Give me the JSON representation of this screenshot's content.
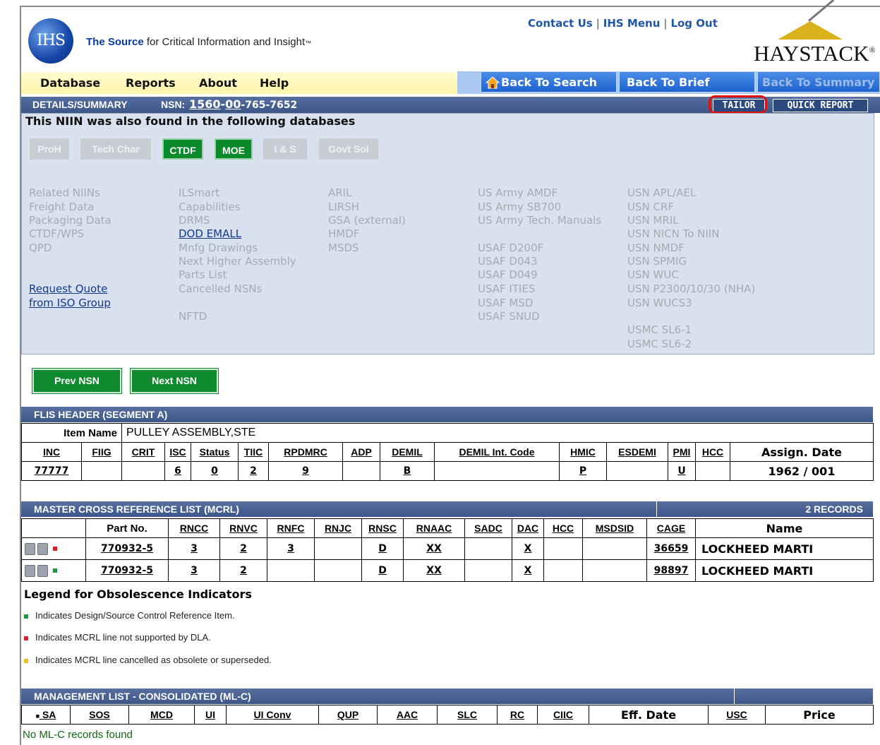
{
  "header": {
    "logo_text": "IHS",
    "tagline_brand": "The Source",
    "tagline_rest": " for Critical Information and Insight",
    "tagline_tm": "™",
    "links": [
      "Contact Us",
      "IHS Menu",
      "Log Out"
    ],
    "haystack_logo": "HAYSTACK",
    "haystack_reg": "®"
  },
  "menu": {
    "items": [
      "Database",
      "Reports",
      "About",
      "Help"
    ],
    "back_to_search": "Back To Search",
    "back_to_brief": "Back To Brief",
    "back_to_summary": "Back To Summary",
    "home_icon": "home-icon"
  },
  "details": {
    "label": "DETAILS/SUMMARY",
    "nsn_label": "NSN:",
    "nsn_part1": "1560",
    "nsn_dash1": "-",
    "nsn_part2": "00",
    "nsn_part3": "-765-7652",
    "tailor": "TAILOR",
    "quick_report": "QUICK REPORT"
  },
  "databases": {
    "title": "This NIIN was also found in the following databases",
    "buttons": [
      {
        "label": "ProH",
        "active": false
      },
      {
        "label": "Tech Char",
        "active": false
      },
      {
        "label": "CTDF",
        "active": true
      },
      {
        "label": "MOE",
        "active": true
      },
      {
        "label": "I & S",
        "active": false
      },
      {
        "label": "Govt Sol",
        "active": false
      }
    ],
    "col1": [
      "Related NIINs",
      "Freight Data",
      "Packaging Data",
      "CTDF/WPS",
      "QPD"
    ],
    "request_quote_1": "Request Quote",
    "request_quote_2": "from ISO Group",
    "col2": [
      "ILSmart",
      "Capabilities",
      "DRMS",
      "DOD EMALL",
      "Mnfg Drawings",
      "Next Higher Assembly",
      "Parts List",
      "Cancelled NSNs",
      "",
      "NFTD"
    ],
    "col3": [
      "ARIL",
      "LIRSH",
      "GSA (external)",
      "HMDF",
      "MSDS"
    ],
    "col4a": [
      "US Army AMDF",
      "US Army SB700",
      "US Army Tech. Manuals"
    ],
    "col4b": [
      "USAF D200F",
      "USAF D043",
      "USAF D049",
      "USAF ITIES",
      "USAF MSD",
      "USAF SNUD"
    ],
    "col5a": [
      "USN APL/AEL",
      "USN CRF",
      "USN MRIL",
      "USN NICN To NIIN",
      "USN NMDF",
      "USN SPMIG",
      "USN WUC",
      "USN P2300/10/30 (NHA)",
      "USN WUCS3"
    ],
    "col5b": [
      "USMC SL6-1",
      "USMC SL6-2"
    ]
  },
  "nav": {
    "prev": "Prev NSN",
    "next": "Next NSN"
  },
  "flis": {
    "title": "FLIS HEADER (SEGMENT A)",
    "item_name_label": "Item Name",
    "item_name": "PULLEY ASSEMBLY,STE",
    "headers": [
      "INC",
      "FIIG",
      "CRIT",
      "ISC",
      "Status",
      "TIIC",
      "RPDMRC",
      "ADP",
      "DEMIL",
      "DEMIL Int. Code",
      "HMIC",
      "ESDEMI",
      "PMI",
      "HCC",
      "Assign. Date"
    ],
    "row": [
      "77777",
      "",
      "",
      "6",
      "0",
      "2",
      "9",
      "",
      "B",
      "",
      "P",
      "",
      "U",
      "",
      "1962 / 001"
    ]
  },
  "mcrl": {
    "title": "MASTER CROSS REFERENCE LIST (MCRL)",
    "records": "2 RECORDS",
    "headers": [
      "",
      "Part No.",
      "RNCC",
      "RNVC",
      "RNFC",
      "RNJC",
      "RNSC",
      "RNAAC",
      "SADC",
      "DAC",
      "HCC",
      "MSDSID",
      "CAGE",
      "Name"
    ],
    "rows": [
      {
        "indicator": "#e02020",
        "cells": [
          "770932-5",
          "3",
          "2",
          "3",
          "",
          "D",
          "XX",
          "",
          "X",
          "",
          "",
          "36659",
          "LOCKHEED MARTI"
        ]
      },
      {
        "indicator": "#1a9a3a",
        "cells": [
          "770932-5",
          "3",
          "2",
          "",
          "",
          "D",
          "XX",
          "",
          "X",
          "",
          "",
          "98897",
          "LOCKHEED MARTI"
        ]
      }
    ]
  },
  "legend": {
    "title": "Legend for Obsolescence Indicators",
    "items": [
      {
        "color": "#1a9a3a",
        "text": "Indicates Design/Source Control Reference Item."
      },
      {
        "color": "#e02020",
        "text": "Indicates MCRL line not supported by DLA."
      },
      {
        "color": "#f0c020",
        "text": "Indicates MCRL line cancelled as obsolete or superseded."
      }
    ]
  },
  "mlc": {
    "title": "MANAGEMENT LIST - CONSOLIDATED (ML-C)",
    "headers": [
      "SA",
      "SOS",
      "MCD",
      "UI",
      "UI Conv",
      "QUP",
      "AAC",
      "SLC",
      "RC",
      "CIIC",
      "Eff. Date",
      "USC",
      "Price"
    ],
    "empty": "No ML-C records found"
  }
}
